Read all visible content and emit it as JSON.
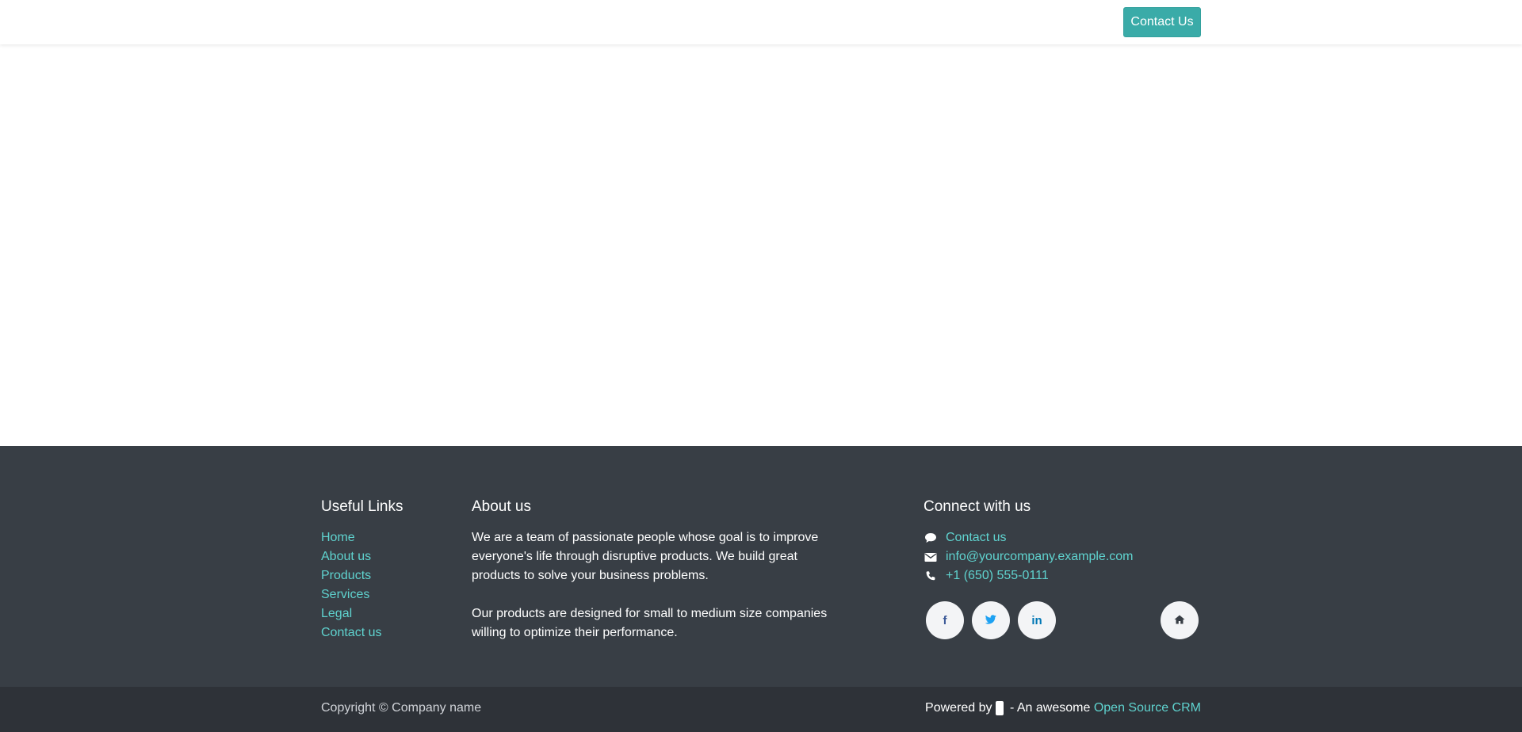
{
  "header": {
    "contact_button": "Contact Us"
  },
  "footer": {
    "useful_links": {
      "title": "Useful Links",
      "items": [
        "Home",
        "About us",
        "Products",
        "Services",
        "Legal",
        "Contact us"
      ]
    },
    "about": {
      "title": "About us",
      "paragraph1": "We are a team of passionate people whose goal is to improve everyone's life through disruptive products. We build great products to solve your business problems.",
      "paragraph2": "Our products are designed for small to medium size companies willing to optimize their performance."
    },
    "connect": {
      "title": "Connect with us",
      "items": [
        {
          "icon": "comment-icon",
          "label": "Contact us"
        },
        {
          "icon": "envelope-icon",
          "label": "info@yourcompany.example.com"
        },
        {
          "icon": "phone-icon",
          "label": "+1 (650) 555-0111"
        }
      ],
      "social": [
        {
          "icon": "facebook-icon",
          "glyph": "f",
          "color": "#3b5998"
        },
        {
          "icon": "twitter-icon",
          "glyph": "t",
          "color": "#1da1f2"
        },
        {
          "icon": "linkedin-icon",
          "glyph": "in",
          "color": "#0077b5"
        },
        {
          "icon": "home-icon",
          "glyph": "⌂",
          "color": "#383e45"
        }
      ]
    }
  },
  "bottombar": {
    "copyright": "Copyright © Company name",
    "powered_prefix": "Powered by",
    "powered_middle": " - An awesome ",
    "powered_link": "Open Source CRM"
  },
  "colors": {
    "accent": "#3aaba8",
    "link": "#5fd3cf",
    "footer_bg": "#383e45",
    "bottombar_bg": "#2e3238"
  }
}
